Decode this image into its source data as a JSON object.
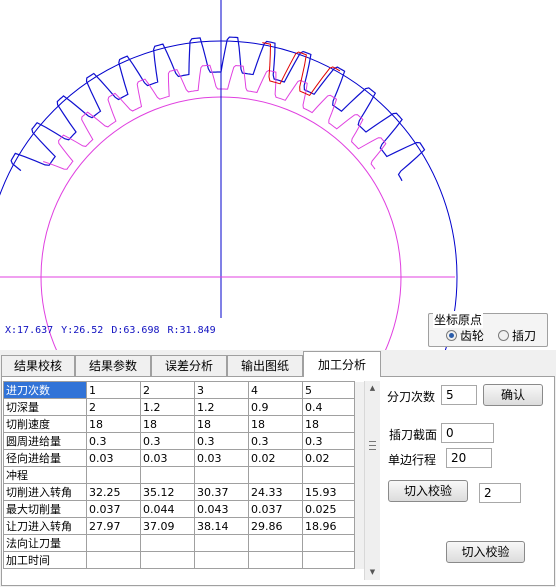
{
  "status_bar": {
    "x": "X:17.637",
    "y": "Y:26.52",
    "d": "D:63.698",
    "r": "R:31.849"
  },
  "origin_group": {
    "title": "坐标原点",
    "options": [
      {
        "label": "齿轮",
        "selected": true
      },
      {
        "label": "插刀",
        "selected": false
      }
    ]
  },
  "tabs": [
    {
      "label": "结果校核",
      "active": false
    },
    {
      "label": "结果参数",
      "active": false
    },
    {
      "label": "误差分析",
      "active": false
    },
    {
      "label": "输出图纸",
      "active": false
    },
    {
      "label": "加工分析",
      "active": true
    }
  ],
  "table": {
    "header": [
      "进刀次数",
      "1",
      "2",
      "3",
      "4",
      "5"
    ],
    "rows": [
      [
        "切深量",
        "2",
        "1.2",
        "1.2",
        "0.9",
        "0.4"
      ],
      [
        "切削速度",
        "18",
        "18",
        "18",
        "18",
        "18"
      ],
      [
        "圆周进给量",
        "0.3",
        "0.3",
        "0.3",
        "0.3",
        "0.3"
      ],
      [
        "径向进给量",
        "0.03",
        "0.03",
        "0.03",
        "0.02",
        "0.02"
      ],
      [
        "冲程",
        "",
        "",
        "",
        "",
        ""
      ],
      [
        "切削进入转角",
        "32.25",
        "35.12",
        "30.37",
        "24.33",
        "15.93"
      ],
      [
        "最大切削量",
        "0.037",
        "0.044",
        "0.043",
        "0.037",
        "0.025"
      ],
      [
        "让刀进入转角",
        "27.97",
        "37.09",
        "38.14",
        "29.86",
        "18.96"
      ],
      [
        "法向让刀量",
        "",
        "",
        "",
        "",
        ""
      ],
      [
        "加工时间",
        "",
        "",
        "",
        "",
        ""
      ]
    ]
  },
  "controls": {
    "passes_label": "分刀次数",
    "passes_value": "5",
    "confirm_label": "确认",
    "section_label": "插刀截面",
    "section_value": "0",
    "stroke_label": "单边行程",
    "stroke_value": "20",
    "cut_in_check_label": "切入校验",
    "cut_in_check_value": "2",
    "cut_in_check_label_2": "切入校验"
  },
  "colors": {
    "gear_profile": "#1010d0",
    "circle_pitch": "#e040e0",
    "cutter": "#e00000",
    "axis": "#0000cc",
    "selected_cell": "#3173d7"
  }
}
